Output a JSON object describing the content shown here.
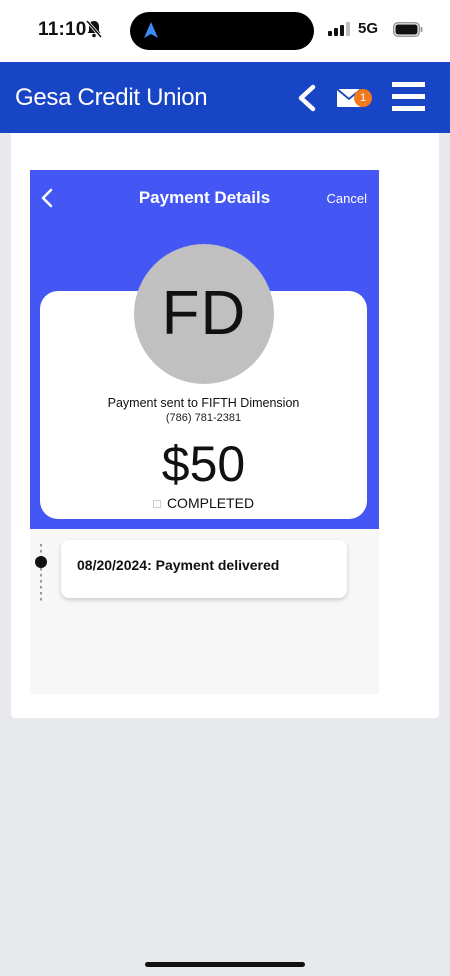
{
  "status_bar": {
    "time": "11:10",
    "network": "5G",
    "icons": [
      "bell-off-icon",
      "location-arrow-icon",
      "signal-icon",
      "battery-icon"
    ]
  },
  "header": {
    "brand": "Gesa Credit Union",
    "mail_badge": "1",
    "icons": [
      "back-chevron-icon",
      "mail-icon",
      "menu-icon"
    ],
    "brand_color": "#1845c5",
    "badge_color": "#f27a1c"
  },
  "details": {
    "title": "Payment Details",
    "cancel_label": "Cancel",
    "avatar_initials": "FD",
    "sent_to": "Payment sent to FIFTH Dimension",
    "phone": "(786) 781-2381",
    "amount": "$50",
    "status": "COMPLETED",
    "band_color": "#4457f5"
  },
  "timeline": {
    "events": [
      {
        "text": "08/20/2024: Payment delivered"
      }
    ]
  }
}
